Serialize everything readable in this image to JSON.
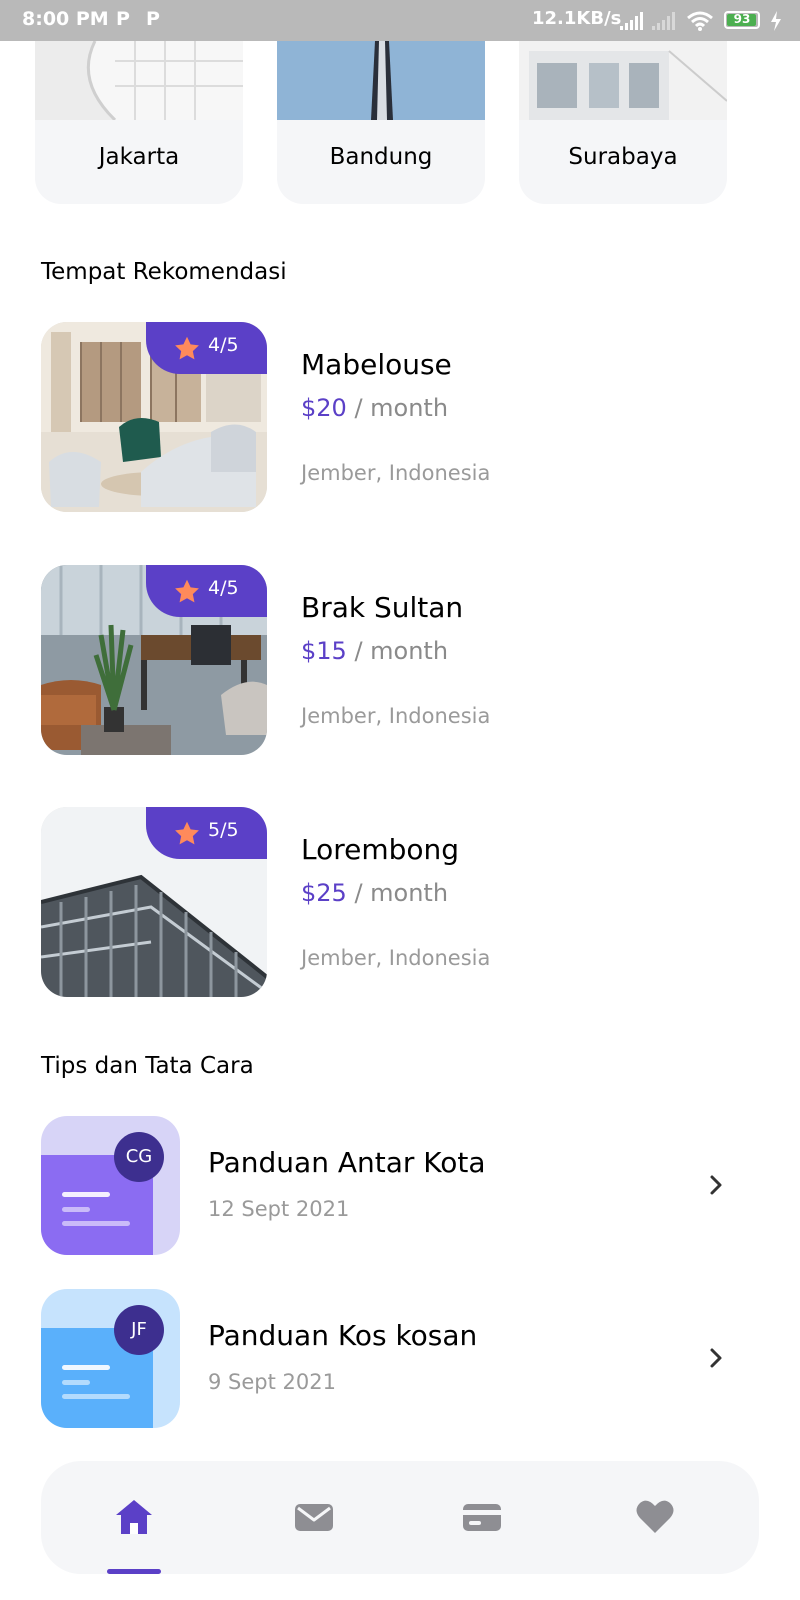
{
  "status_bar": {
    "time": "8:00 PM",
    "notif_1": "P",
    "notif_2": "P",
    "network_speed": "12.1KB/s",
    "battery": "93"
  },
  "cities": [
    {
      "name": "Jakarta"
    },
    {
      "name": "Bandung"
    },
    {
      "name": "Surabaya"
    }
  ],
  "recommendations": {
    "title": "Tempat Rekomendasi",
    "items": [
      {
        "name": "Mabelouse",
        "price": "$20",
        "period": " / month",
        "location": "Jember, Indonesia",
        "rating": "4/5"
      },
      {
        "name": "Brak Sultan",
        "price": "$15",
        "period": " / month",
        "location": "Jember, Indonesia",
        "rating": "4/5"
      },
      {
        "name": "Lorembong",
        "price": "$25",
        "period": " / month",
        "location": "Jember, Indonesia",
        "rating": "5/5"
      }
    ]
  },
  "tips": {
    "title": "Tips dan Tata Cara",
    "items": [
      {
        "title": "Panduan Antar Kota",
        "date": "12 Sept 2021",
        "initials": "CG"
      },
      {
        "title": "Panduan Kos kosan",
        "date": "9 Sept 2021",
        "initials": "JF"
      }
    ]
  },
  "nav": {
    "items": [
      {
        "icon": "home-icon",
        "active": true
      },
      {
        "icon": "mail-icon",
        "active": false
      },
      {
        "icon": "card-icon",
        "active": false
      },
      {
        "icon": "heart-icon",
        "active": false
      }
    ]
  },
  "colors": {
    "accent": "#5b40c7",
    "star": "#ff8a5b",
    "tip_purple": "#8b6cf2",
    "tip_blue": "#5ab0fb",
    "nav_inactive": "#8e8e93"
  }
}
